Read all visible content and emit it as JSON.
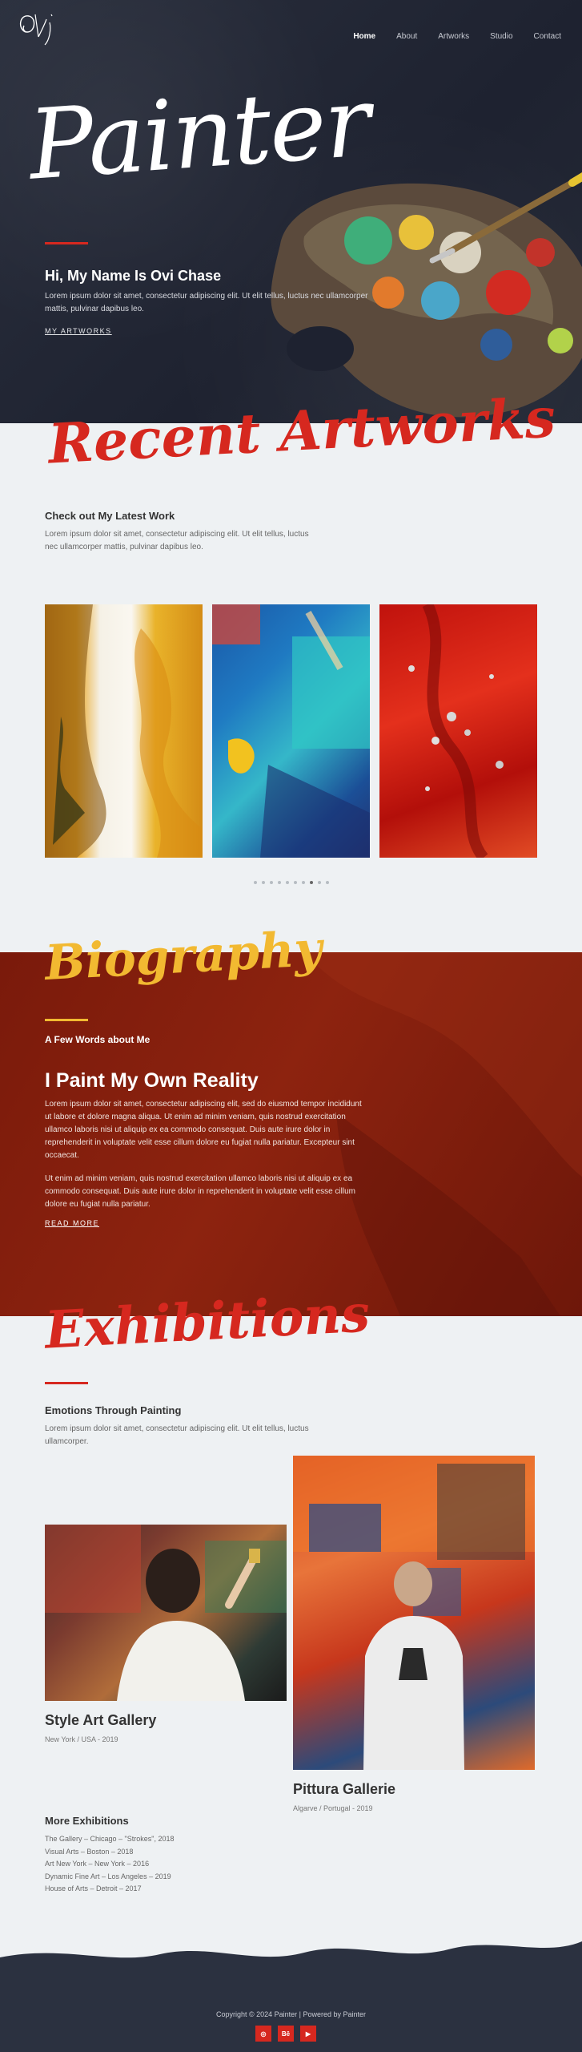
{
  "header": {
    "logo_text": "Ovi",
    "nav": [
      "Home",
      "About",
      "Artworks",
      "Studio",
      "Contact"
    ]
  },
  "hero": {
    "script_title": "Painter",
    "heading": "Hi, My Name Is Ovi Chase",
    "text": "Lorem ipsum dolor sit amet, consectetur adipiscing elit. Ut elit tellus, luctus nec ullamcorper mattis, pulvinar dapibus leo.",
    "link": "MY ARTWORKS"
  },
  "recent": {
    "script_title": "Recent Artworks",
    "heading": "Check out My Latest Work",
    "text": "Lorem ipsum dolor sit amet, consectetur adipiscing elit. Ut elit tellus, luctus nec ullamcorper mattis, pulvinar dapibus leo.",
    "artworks": [
      "abstract-yellow-white",
      "abstract-blue-teal",
      "abstract-red"
    ],
    "active_dot": 7,
    "dot_count": 10
  },
  "biography": {
    "script_title": "Biography",
    "small": "A Few Words about Me",
    "heading": "I Paint My Own Reality",
    "para1": "Lorem ipsum dolor sit amet, consectetur adipiscing elit, sed do eiusmod tempor incididunt ut labore et dolore magna aliqua. Ut enim ad minim veniam, quis nostrud exercitation ullamco laboris nisi ut aliquip ex ea commodo consequat. Duis aute irure dolor in reprehenderit in voluptate velit esse cillum dolore eu fugiat nulla pariatur. Excepteur sint occaecat.",
    "para2": "Ut enim ad minim veniam, quis nostrud exercitation ullamco laboris nisi ut aliquip ex ea commodo consequat. Duis aute irure dolor in reprehenderit in voluptate velit esse cillum dolore eu fugiat nulla pariatur.",
    "link": "READ MORE"
  },
  "exhibitions": {
    "script_title": "Exhibitions",
    "heading": "Emotions Through Painting",
    "text": "Lorem ipsum dolor sit amet, consectetur adipiscing elit. Ut elit tellus, luctus ullamcorper.",
    "galleries": [
      {
        "name": "Style Art Gallery",
        "meta": "New York / USA - 2019"
      },
      {
        "name": "Pittura Gallerie",
        "meta": "Algarve / Portugal - 2019"
      }
    ],
    "more_title": "More Exhibitions",
    "more": [
      "The Gallery – Chicago – \"Strokes\", 2018",
      "Visual Arts – Boston – 2018",
      "Art New York – New York – 2016",
      "Dynamic Fine Art – Los Angeles – 2019",
      "House of Arts – Detroit – 2017"
    ]
  },
  "footer": {
    "copyright": "Copyright © 2024 Painter | Powered by Painter",
    "socials": [
      "dribbble",
      "behance",
      "youtube"
    ]
  },
  "colors": {
    "accent": "#d6281f",
    "dark": "#2a2f3d",
    "bio_bg": "#8d230f",
    "script_yellow": "#f2b931"
  }
}
